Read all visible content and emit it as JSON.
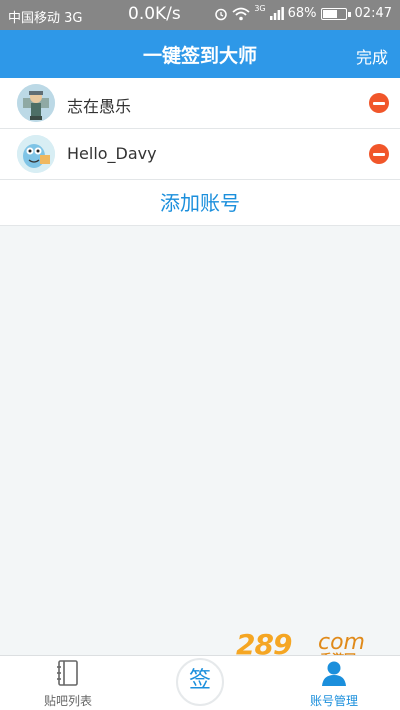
{
  "status_bar": {
    "carrier": "中国移动 3G",
    "speed": "0.0K/s",
    "network": "3G",
    "battery": "68%",
    "time": "02:47"
  },
  "header": {
    "title": "一键签到大师",
    "done_label": "完成"
  },
  "accounts": [
    {
      "name": "志在愚乐"
    },
    {
      "name": "Hello_Davy"
    }
  ],
  "add_account_label": "添加账号",
  "bottom_nav": {
    "left_label": "贴吧列表",
    "center_label": "签",
    "right_label": "账号管理"
  },
  "watermark": {
    "number": "289",
    "domain": "com",
    "sub": "手游网"
  },
  "colors": {
    "header_bg": "#2e98e8",
    "accent": "#1b8fdc",
    "remove": "#f1562a",
    "status_bar_bg": "#868686"
  }
}
